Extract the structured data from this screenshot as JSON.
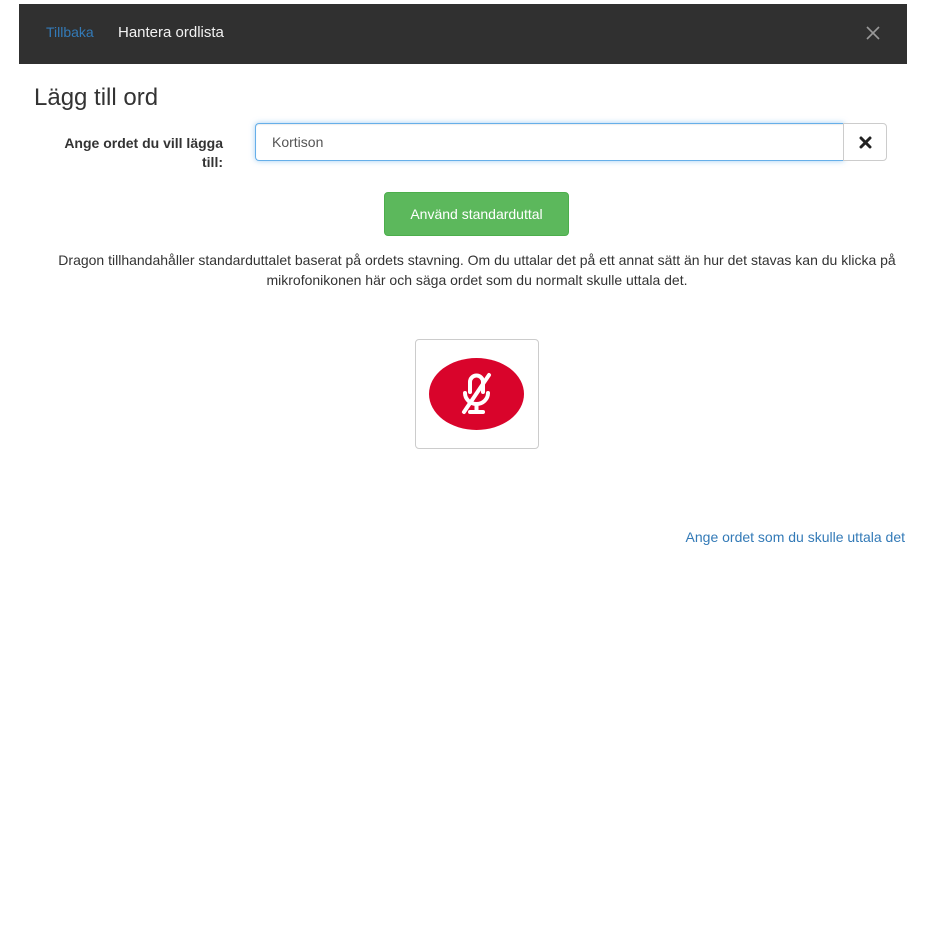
{
  "header": {
    "back_label": "Tillbaka",
    "title": "Hantera ordlista",
    "close_icon": "close-icon"
  },
  "main": {
    "title": "Lägg till ord",
    "field_label": "Ange ordet du vill lägga till:",
    "word_value": "Kortison",
    "clear_icon": "times-icon",
    "standard_button_label": "Använd standarduttal",
    "description": "Dragon tillhandahåller standarduttalet baserat på ordets stavning. Om du uttalar det på ett annat sätt än hur det stavas kan du klicka på mikrofonikonen här och säga ordet som du normalt skulle uttala det.",
    "mic_icon": "microphone-off-icon",
    "pronounce_link": "Ange ordet som du skulle uttala det"
  },
  "colors": {
    "header_bg": "#303030",
    "link": "#337ab7",
    "success": "#5cb85c",
    "mic_red": "#d9042b"
  }
}
